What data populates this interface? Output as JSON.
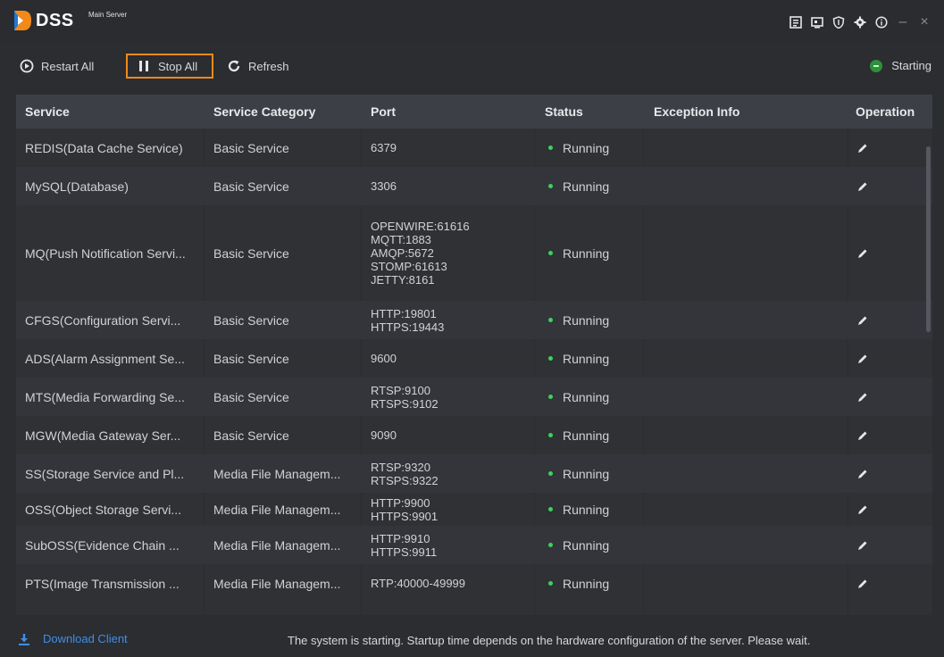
{
  "app": {
    "brand": "DSS",
    "subtitle": "Main Server",
    "title_icons": [
      "log-icon",
      "monitor-icon",
      "shield-icon",
      "gear-icon",
      "info-icon",
      "minimize-icon",
      "close-icon"
    ]
  },
  "toolbar": {
    "restart_label": "Restart All",
    "stop_label": "Stop All",
    "refresh_label": "Refresh",
    "status_label": "Starting"
  },
  "table": {
    "columns": [
      "Service",
      "Service Category",
      "Port",
      "Status",
      "Exception Info",
      "Operation"
    ],
    "rows": [
      {
        "service": "REDIS(Data Cache Service)",
        "category": "Basic Service",
        "port": [
          "6379"
        ],
        "status": "Running",
        "exception": ""
      },
      {
        "service": "MySQL(Database)",
        "category": "Basic Service",
        "port": [
          "3306"
        ],
        "status": "Running",
        "exception": ""
      },
      {
        "service": "MQ(Push Notification Servi...",
        "category": "Basic Service",
        "port": [
          "OPENWIRE:61616",
          "MQTT:1883",
          "AMQP:5672",
          "STOMP:61613",
          "JETTY:8161"
        ],
        "status": "Running",
        "exception": ""
      },
      {
        "service": "CFGS(Configuration Servi...",
        "category": "Basic Service",
        "port": [
          "HTTP:19801",
          "HTTPS:19443"
        ],
        "status": "Running",
        "exception": ""
      },
      {
        "service": "ADS(Alarm Assignment Se...",
        "category": "Basic Service",
        "port": [
          "9600"
        ],
        "status": "Running",
        "exception": ""
      },
      {
        "service": "MTS(Media Forwarding Se...",
        "category": "Basic Service",
        "port": [
          "RTSP:9100",
          "RTSPS:9102"
        ],
        "status": "Running",
        "exception": ""
      },
      {
        "service": "MGW(Media Gateway Ser...",
        "category": "Basic Service",
        "port": [
          "9090"
        ],
        "status": "Running",
        "exception": ""
      },
      {
        "service": "SS(Storage Service and Pl...",
        "category": "Media File Managem...",
        "port": [
          "RTSP:9320",
          "RTSPS:9322"
        ],
        "status": "Running",
        "exception": ""
      },
      {
        "service": "OSS(Object Storage Servi...",
        "category": "Media File Managem...",
        "port": [
          "HTTP:9900",
          "HTTPS:9901"
        ],
        "status": "Running",
        "exception": ""
      },
      {
        "service": "SubOSS(Evidence Chain ...",
        "category": "Media File Managem...",
        "port": [
          "HTTP:9910",
          "HTTPS:9911"
        ],
        "status": "Running",
        "exception": ""
      },
      {
        "service": "PTS(Image Transmission ...",
        "category": "Media File Managem...",
        "port": [
          "RTP:40000-49999"
        ],
        "status": "Running",
        "exception": ""
      }
    ]
  },
  "footer": {
    "download_label": "Download Client",
    "message": "The system is starting. Startup time depends on the hardware configuration of the server. Please wait."
  },
  "colors": {
    "accent_orange": "#ee8a1b",
    "running_green": "#3dd15a",
    "link_blue": "#3f8ee6",
    "background": "#2b2d31"
  }
}
